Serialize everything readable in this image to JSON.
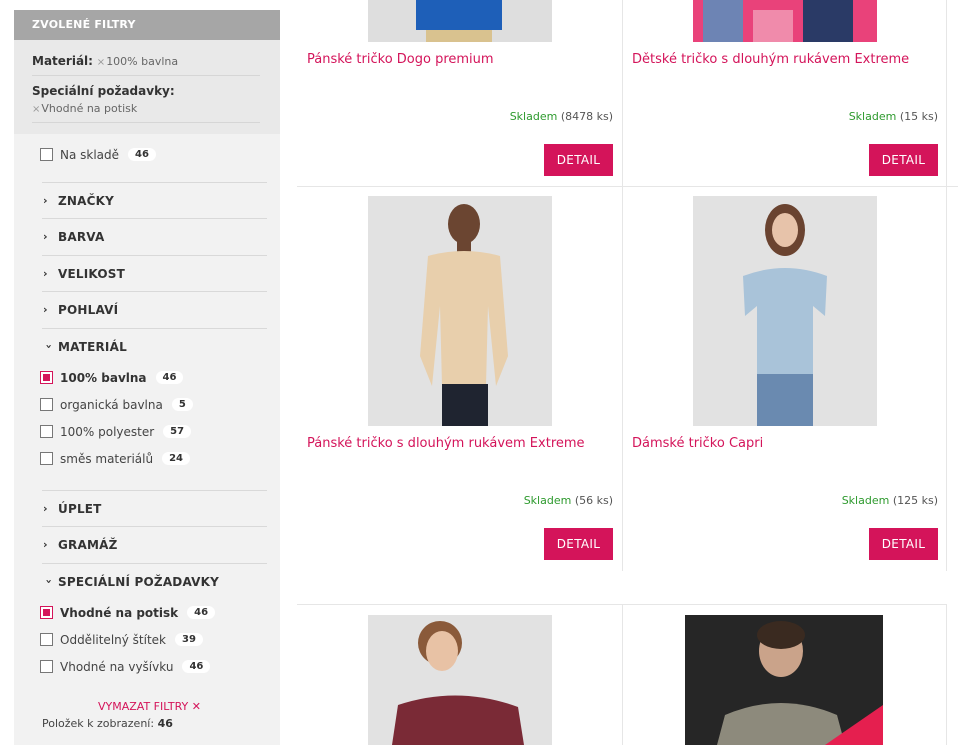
{
  "filters": {
    "header": "ZVOLENÉ FILTRY",
    "chosen": [
      {
        "label": "Materiál:",
        "value": "100% bavlna"
      },
      {
        "label": "Speciální požadavky:",
        "value": "Vhodné na potisk"
      }
    ],
    "remove_mark": "×",
    "in_stock": {
      "label": "Na skladě",
      "count": "46"
    },
    "sections": {
      "brands": "ZNAČKY",
      "color": "BARVA",
      "size": "VELIKOST",
      "gender": "POHLAVÍ",
      "material": "MATERIÁL",
      "knit": "ÚPLET",
      "weight": "GRAMÁŽ",
      "special": "SPECIÁLNÍ POŽADAVKY"
    },
    "material_options": [
      {
        "label": "100% bavlna",
        "count": "46",
        "checked": true
      },
      {
        "label": "organická bavlna",
        "count": "5",
        "checked": false
      },
      {
        "label": "100% polyester",
        "count": "57",
        "checked": false
      },
      {
        "label": "směs materiálů",
        "count": "24",
        "checked": false
      }
    ],
    "special_options": [
      {
        "label": "Vhodné na potisk",
        "count": "46",
        "checked": true
      },
      {
        "label": "Oddělitelný štítek",
        "count": "39",
        "checked": false
      },
      {
        "label": "Vhodné na vyšívku",
        "count": "46",
        "checked": false
      }
    ],
    "clear_label": "VYMAZAT FILTRY",
    "clear_icon": "✕",
    "items_label": "Položek k zobrazení:",
    "items_count": "46"
  },
  "products": [
    {
      "title": "Pánské tričko Dogo premium",
      "stock_label": "Skladem",
      "stock_qty": "(8478 ks)",
      "button": "DETAIL"
    },
    {
      "title": "Dětské tričko s dlouhým rukávem Extreme",
      "stock_label": "Skladem",
      "stock_qty": "(15 ks)",
      "button": "DETAIL"
    },
    {
      "title": "Pánské tričko s dlouhým rukávem Extreme",
      "stock_label": "Skladem",
      "stock_qty": "(56 ks)",
      "button": "DETAIL"
    },
    {
      "title": "Dámské tričko Capri",
      "stock_label": "Skladem",
      "stock_qty": "(125 ks)",
      "button": "DETAIL"
    }
  ],
  "colors": {
    "accent": "#d4145a",
    "stock_green": "#2e9a2e",
    "sidebar_bg": "#f2f2f2",
    "sidebar_head": "#a6a6a6"
  }
}
